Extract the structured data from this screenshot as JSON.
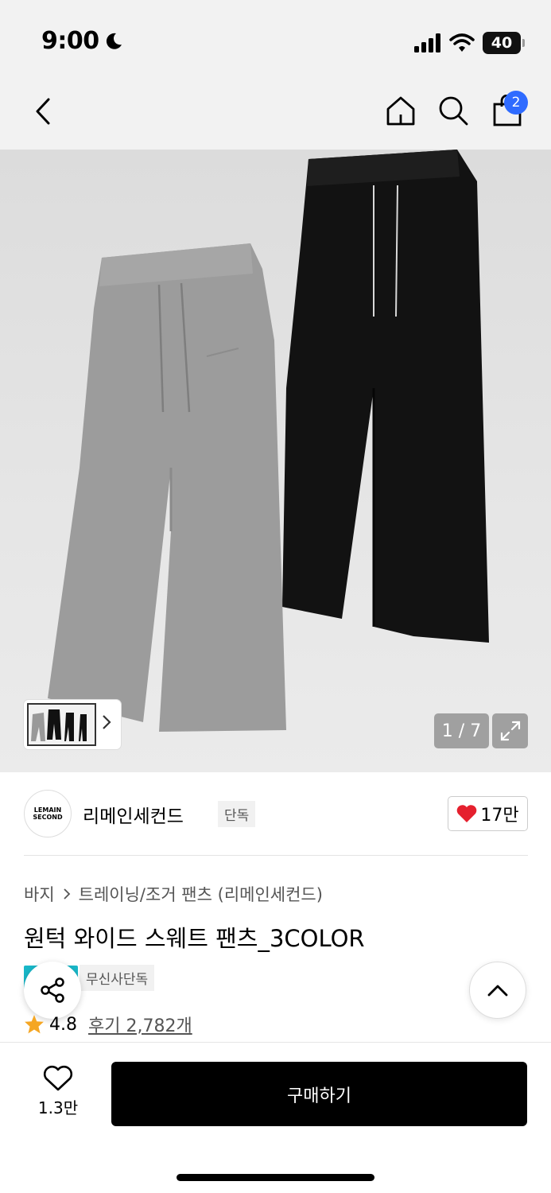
{
  "status_bar": {
    "time": "9:00",
    "battery": "40"
  },
  "header": {
    "cart_count": "2"
  },
  "gallery": {
    "counter": "1 / 7"
  },
  "brand": {
    "logo_line1": "LEMAIN",
    "logo_line2": "SECOND",
    "name": "리메인세컨드",
    "tag": "단독",
    "likes": "17만"
  },
  "breadcrumb": {
    "category": "바지",
    "subcategory": "트레이닝/조거 팬츠 (리메인세컨드)"
  },
  "product": {
    "title": "원턱 와이드 스웨트 팬츠_3COLOR",
    "exclusive_tag": "무신사단독",
    "rating": "4.8",
    "reviews": "후기 2,782개"
  },
  "bottom_bar": {
    "wish_count": "1.3만",
    "buy_label": "구매하기"
  },
  "colors": {
    "accent_blue": "#2f6bff",
    "star": "#f5a623",
    "heart": "#e5202e",
    "teal": "#19b7c8"
  }
}
